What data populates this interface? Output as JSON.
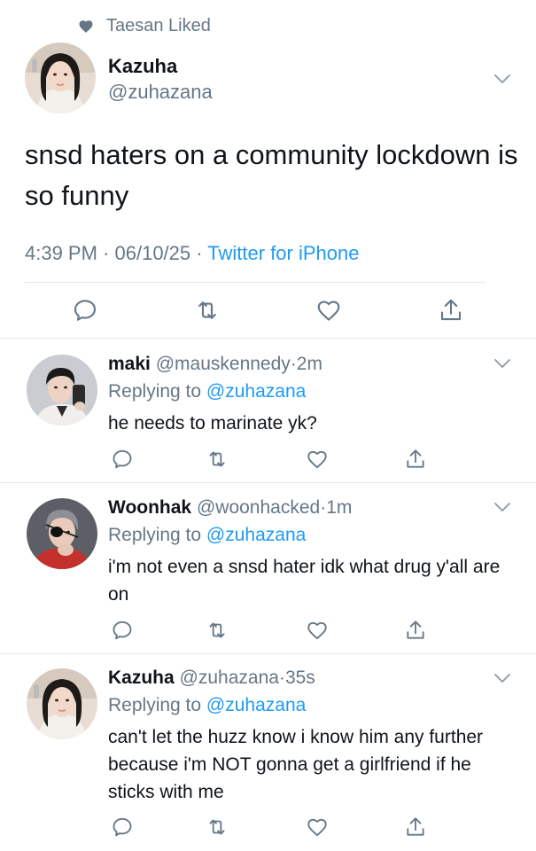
{
  "social_context": {
    "text": "Taesan Liked"
  },
  "main_tweet": {
    "name": "Kazuha",
    "handle": "@zuhazana",
    "text": "snsd haters on a community lockdown is so funny",
    "time": "4:39 PM",
    "sep1": " · ",
    "date": "06/10/25",
    "sep2": " · ",
    "source": "Twitter for iPhone"
  },
  "replies": [
    {
      "name": "maki",
      "handle": "@mauskennedy",
      "dot": "·",
      "time": "2m",
      "replying_label": "Replying to",
      "replying_to": "@zuhazana",
      "text": "he needs to marinate yk?"
    },
    {
      "name": "Woonhak",
      "handle": "@woonhacked",
      "dot": "·",
      "time": "1m",
      "replying_label": "Replying to",
      "replying_to": "@zuhazana",
      "text": "i'm not even a snsd hater idk what drug y'all are on"
    },
    {
      "name": "Kazuha",
      "handle": "@zuhazana",
      "dot": "·",
      "time": "35s",
      "replying_label": "Replying to",
      "replying_to": "@zuhazana",
      "text": "can't let the huzz know i know him any further because i'm NOT gonna get a girlfriend if he sticks with me"
    }
  ],
  "colors": {
    "accent": "#1d9bf0",
    "secondary": "#657786",
    "divider": "#e1e8ed"
  }
}
